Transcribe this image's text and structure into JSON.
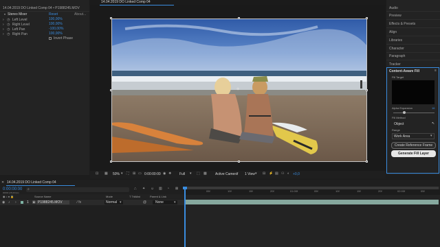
{
  "effect_controls": {
    "title": "14.04.2019 DO Linked Comp 04 • P1988245.MOV",
    "effect_name": "Stereo Mixer",
    "reset": "Reset",
    "about": "About...",
    "rows": [
      {
        "label": "Left Level",
        "value": "100,00%"
      },
      {
        "label": "Right Level",
        "value": "100,00%"
      },
      {
        "label": "Left Pan",
        "value": "-100,00%"
      },
      {
        "label": "Right Pan",
        "value": "100,00%"
      }
    ],
    "invert_phase": "Invert Phase"
  },
  "composition": {
    "tab": "14.04.2019 DO Linked Comp 04",
    "zoom": "50%",
    "timecode": "0:00:00:00",
    "resolution": "Full",
    "camera": "Active Camera",
    "view": "1 View",
    "exposure": "+0,0"
  },
  "panels": [
    "Audio",
    "Preview",
    "Effects & Presets",
    "Align",
    "Libraries",
    "Character",
    "Paragraph",
    "Tracker"
  ],
  "content_aware_fill": {
    "title": "Content-Aware Fill",
    "fill_target_label": "Fill Target",
    "alpha_expansion_label": "Alpha Expansion",
    "alpha_expansion_value": "16",
    "fill_method_label": "Fill Method",
    "fill_method_value": "Object",
    "range_label": "Range",
    "range_value": "Work Area",
    "create_reference_label": "Create Reference Frame",
    "generate_label": "Generate Fill Layer"
  },
  "timeline": {
    "tab": "14.04.2019 DO Linked Comp 04",
    "current_time": "0:00:00:00",
    "frame_info": "00000 (25,00 fps)",
    "columns": [
      "Source Name",
      "Mode",
      "T TrkMat",
      "Parent & Link"
    ],
    "layer": {
      "index": "1",
      "name": "P1988245.MOV",
      "mode": "Normal",
      "parent": "None"
    },
    "ruler": [
      "00f",
      "05f",
      "10f",
      "15f",
      "20f",
      "01:00f",
      "05f",
      "10f",
      "15f",
      "20f",
      "02:00f",
      "05f"
    ]
  }
}
